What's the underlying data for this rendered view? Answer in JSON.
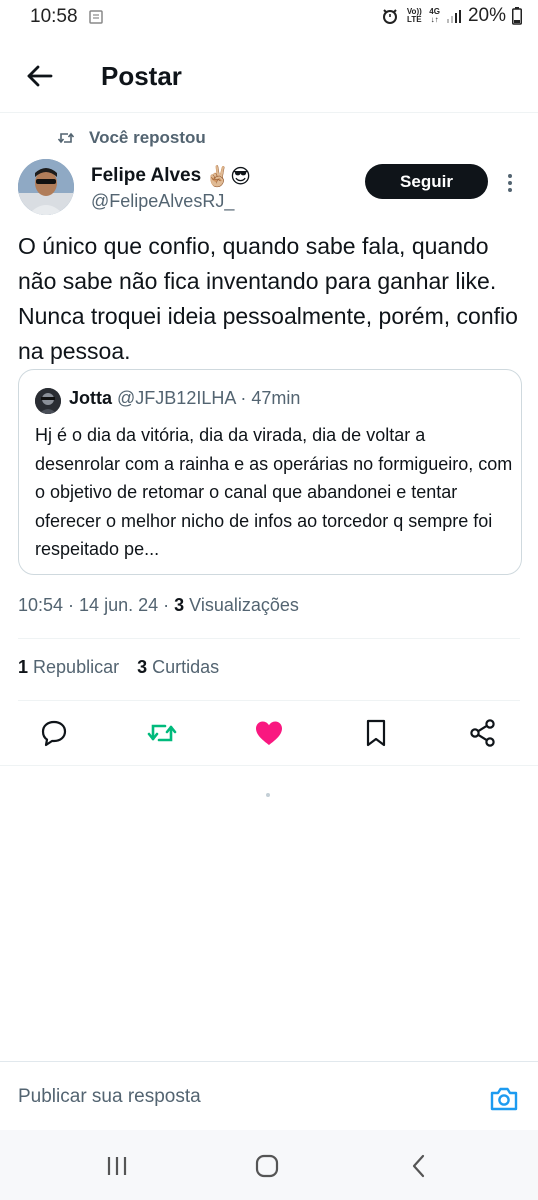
{
  "status_bar": {
    "time": "10:58",
    "battery": "20%",
    "volte": "Vo)) LTE",
    "network": "4G"
  },
  "header": {
    "title": "Postar"
  },
  "repost": {
    "label": "Você repostou"
  },
  "post": {
    "author_name": "Felipe Alves",
    "author_emojis": "✌🏼😎",
    "author_handle": "@FelipeAlvesRJ_",
    "follow_label": "Seguir",
    "text": "O único que confio, quando sabe fala, quando não sabe não fica inventando para ganhar like. Nunca troquei ideia pessoalmente, porém, confio na pessoa.",
    "time": "10:54",
    "date": "14 jun. 24",
    "views_count": "3",
    "views_label": "Visualizações",
    "reposts_count": "1",
    "reposts_label": "Republicar",
    "likes_count": "3",
    "likes_label": "Curtidas"
  },
  "quote": {
    "name": "Jotta",
    "handle": "@JFJB12ILHA",
    "separator": " · ",
    "age": "47min",
    "text": "Hj é o dia da vitória, dia da virada, dia de voltar a desenrolar com a rainha e as operárias no formigueiro,  com o objetivo de retomar o canal que abandonei e tentar oferecer o melhor nicho de infos ao torcedor q sempre foi respeitado pe..."
  },
  "reply": {
    "placeholder": "Publicar sua resposta"
  },
  "colors": {
    "text": "#0f1419",
    "secondary": "#536471",
    "repost_green": "#00ba7c",
    "like_pink": "#f91880",
    "accent_blue": "#1d9bf0",
    "border": "#cfd9de"
  },
  "icons": {
    "back": "arrow-left-icon",
    "repost": "repost-icon",
    "reply": "reply-icon",
    "like": "heart-icon",
    "bookmark": "bookmark-icon",
    "share": "share-icon",
    "camera": "camera-icon",
    "more": "more-vertical-icon"
  }
}
